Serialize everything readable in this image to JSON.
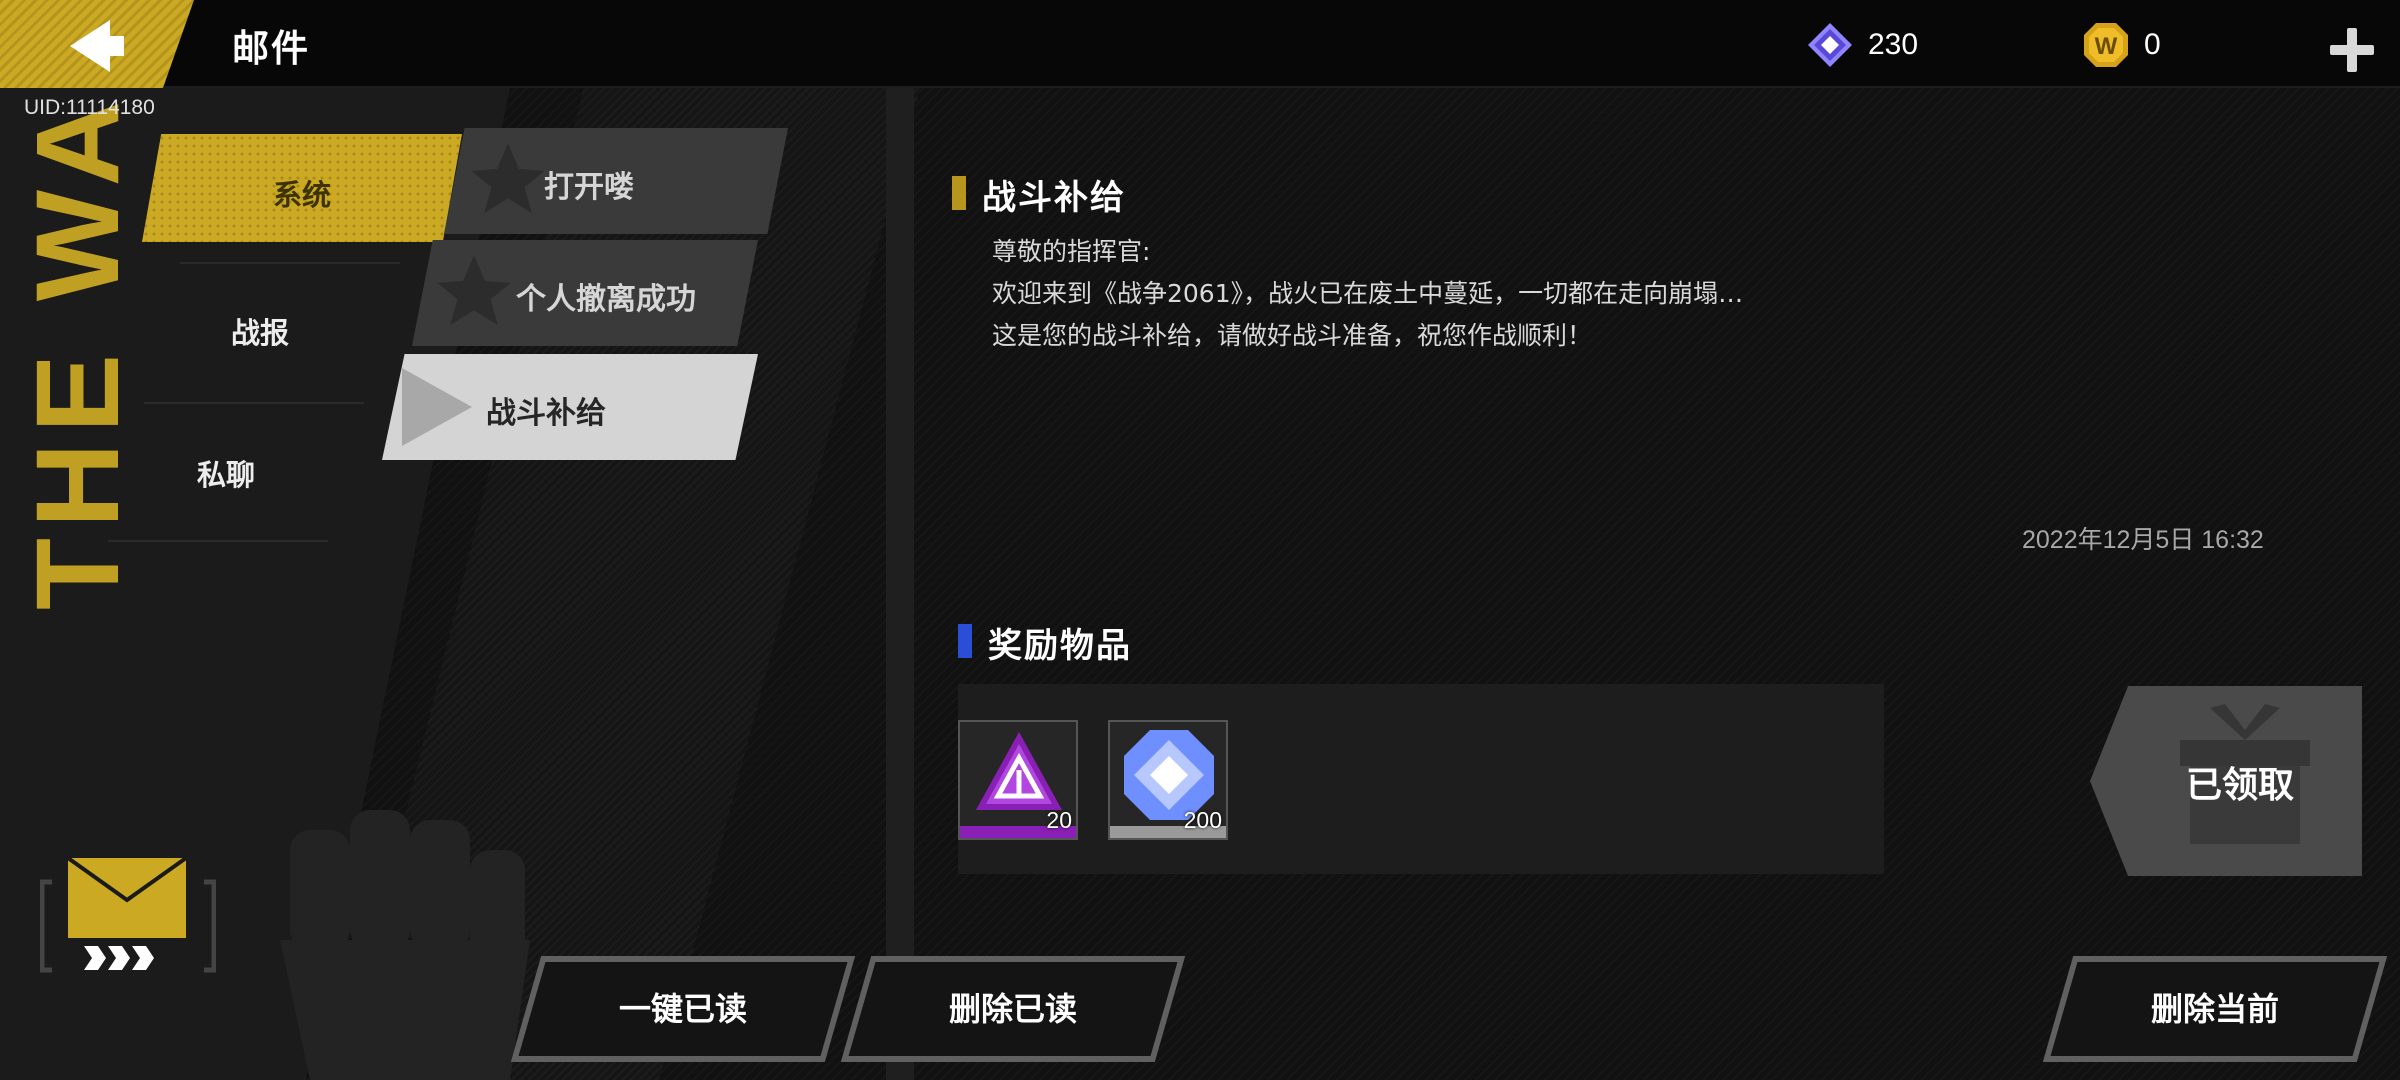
{
  "header": {
    "title": "邮件",
    "uid": "UID:11114180"
  },
  "currencies": [
    {
      "name": "diamond-gem-icon",
      "value": "230"
    },
    {
      "name": "gold-coin-icon",
      "value": "0",
      "coin_letter": "W"
    }
  ],
  "sidebar_text": "THE WAR",
  "categories": {
    "system": "系统",
    "battle_report": "战报",
    "private_chat": "私聊"
  },
  "mail_list": [
    {
      "title": "打开喽",
      "selected": false
    },
    {
      "title": "个人撤离成功",
      "selected": false
    },
    {
      "title": "战斗补给",
      "selected": true
    }
  ],
  "mail": {
    "subject": "战斗补给",
    "lines": [
      "尊敬的指挥官:",
      "欢迎来到《战争2061》，战火已在废土中蔓延，一切都在走向崩塌…",
      "这是您的战斗补给，请做好战斗准备，祝您作战顺利！"
    ],
    "date": "2022年12月5日  16:32",
    "rewards_title": "奖励物品",
    "rewards": [
      {
        "icon": "purple-triangle-emblem-icon",
        "count": "20",
        "rarity_color": "#8a1fb5"
      },
      {
        "icon": "blue-diamond-gem-icon",
        "count": "200",
        "rarity_color": "#9a9a9a"
      }
    ],
    "claimed_label": "已领取"
  },
  "buttons": {
    "mark_all_read": "一键已读",
    "delete_read": "删除已读",
    "delete_current": "删除当前"
  },
  "colors": {
    "accent_yellow": "#cba922",
    "section_mark_gold": "#b8951c",
    "section_mark_blue": "#2a4fd6"
  }
}
